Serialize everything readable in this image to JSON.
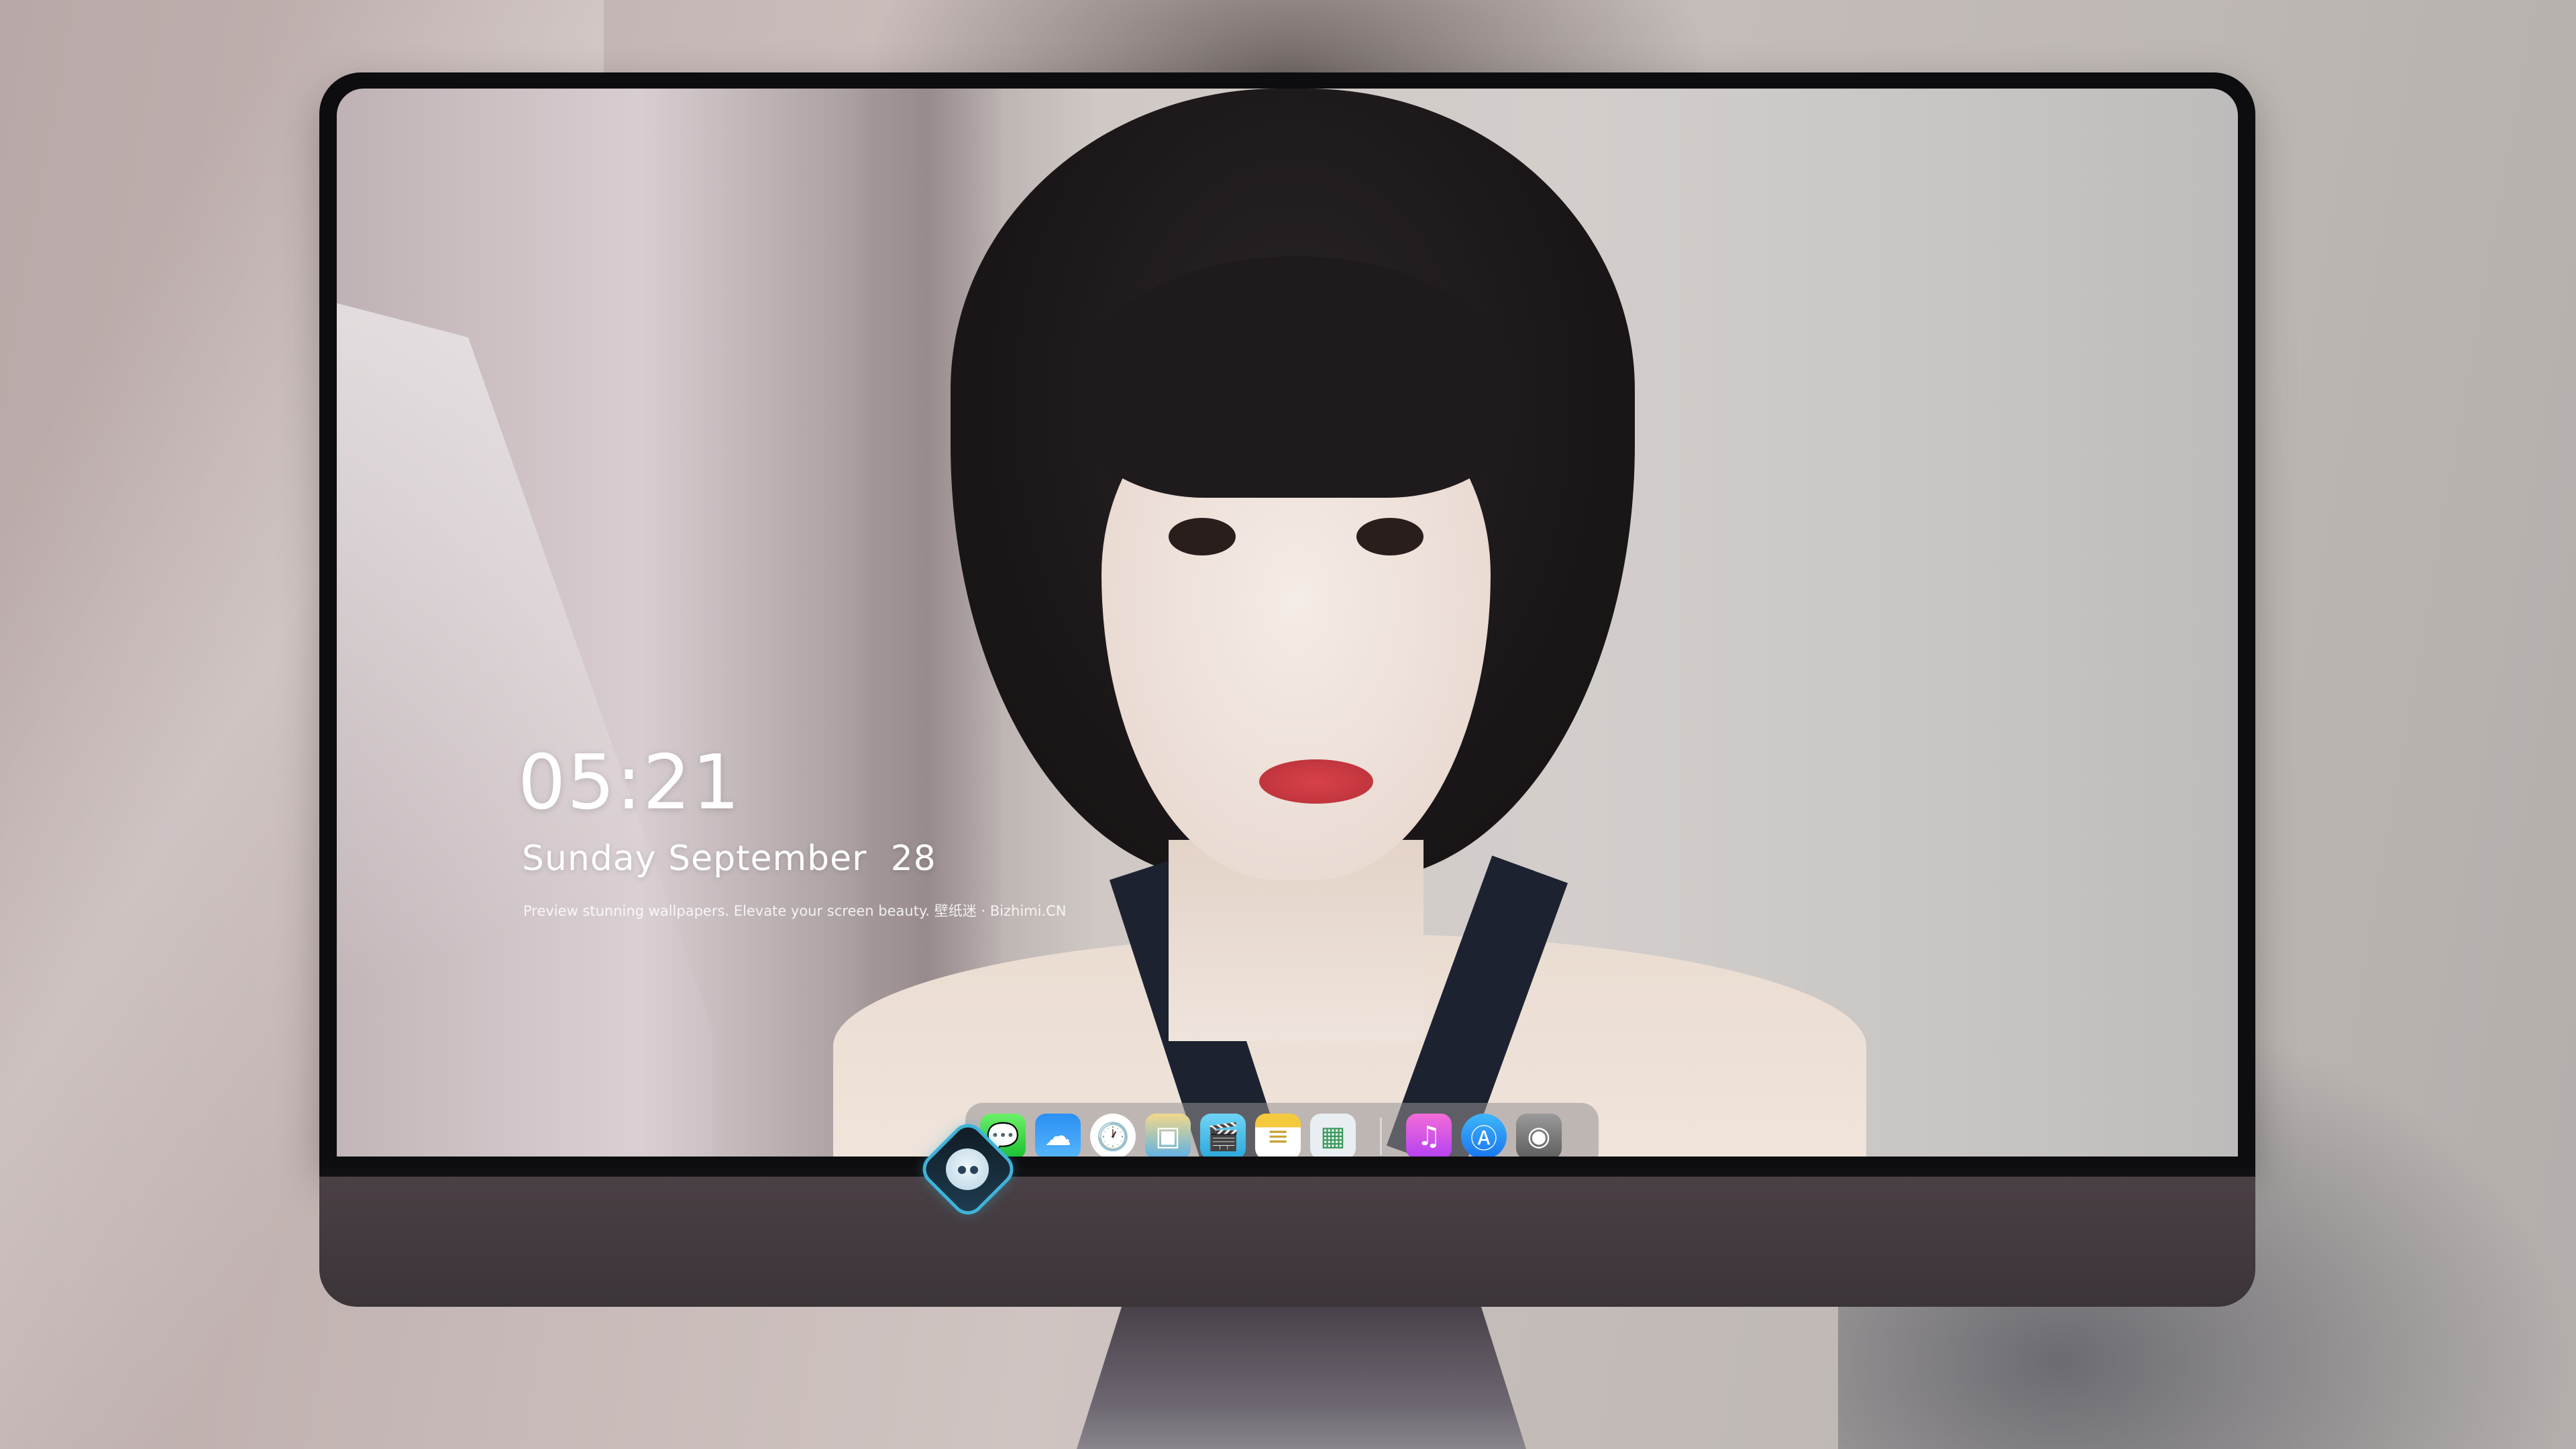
{
  "lockscreen": {
    "time": "05:21",
    "date": "Sunday September  28",
    "tagline": "Preview stunning wallpapers. Elevate your screen beauty. 壁纸迷 · Bizhimi.CN"
  },
  "dock": {
    "apps": [
      {
        "name": "messages-icon",
        "glyph": "💬",
        "color": "#2ad14a"
      },
      {
        "name": "weather-icon",
        "glyph": "☁",
        "color": "#2b8ff5"
      },
      {
        "name": "clock-icon",
        "glyph": "🕐",
        "color": "#ffffff"
      },
      {
        "name": "preview-icon",
        "glyph": "▣",
        "color": "#f1d98a"
      },
      {
        "name": "video-icon",
        "glyph": "🎬",
        "color": "#3ab8e6"
      },
      {
        "name": "notes-icon",
        "glyph": "≡",
        "color": "#f5c93d"
      },
      {
        "name": "photos-icon",
        "glyph": "▦",
        "color": "#e9eef2"
      },
      {
        "name": "music-icon",
        "glyph": "♫",
        "color": "#d054e6"
      },
      {
        "name": "app-store-icon",
        "glyph": "Ⓐ",
        "color": "#2a8ff5"
      },
      {
        "name": "camera-icon",
        "glyph": "◉",
        "color": "#7a7a7a"
      }
    ]
  }
}
